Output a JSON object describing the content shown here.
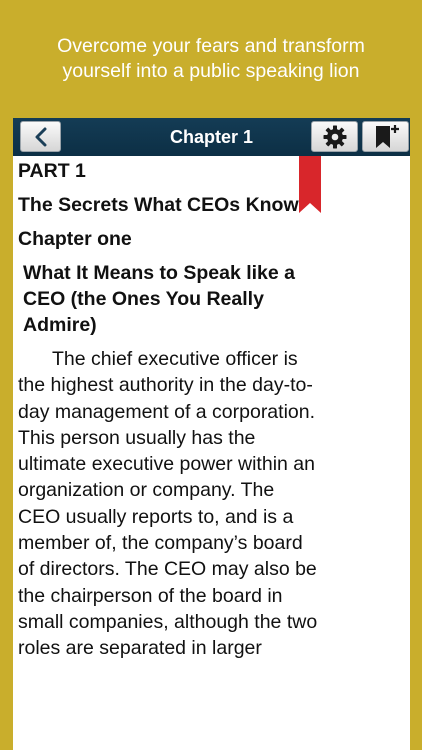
{
  "promo": {
    "line1": "Overcome your fears and transform",
    "line2": "yourself into a public speaking lion"
  },
  "navbar": {
    "title": "Chapter 1",
    "back_icon": "chevron-left-icon",
    "settings_icon": "gear-icon",
    "bookmark_icon": "bookmark-plus-icon"
  },
  "ribbon": {
    "color": "#d8262b"
  },
  "content": {
    "part": "PART 1",
    "section_title": "The Secrets What CEOs Know",
    "chapter_label": "Chapter one",
    "chapter_title": " What It Means to Speak like a CEO (the Ones You Really Admire)",
    "paragraph": "The chief executive officer is the highest authority in the day-to-day management of a corporation. This person usually has the ultimate executive power within an organization or company. The CEO usually reports to, and is a member of, the company’s board of directors. The CEO may also be the chairperson of the board in small companies, although the two roles are separated in larger"
  },
  "colors": {
    "background": "#c9ae2c",
    "navbar": "#0f3650",
    "ribbon": "#d8262b"
  }
}
